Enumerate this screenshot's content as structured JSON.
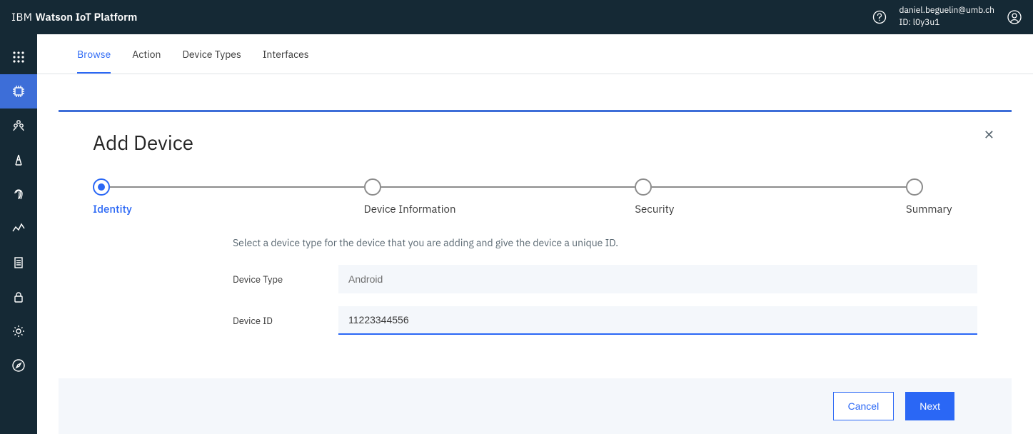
{
  "header": {
    "brand_prefix": "IBM",
    "brand_bold": "Watson IoT Platform",
    "user_email": "daniel.beguelin@umb.ch",
    "user_id_label": "ID: l0y3u1"
  },
  "tabs": {
    "items": [
      "Browse",
      "Action",
      "Device Types",
      "Interfaces"
    ],
    "active_index": 0
  },
  "panel": {
    "title": "Add Device",
    "close_glyph": "✕",
    "steps": [
      "Identity",
      "Device Information",
      "Security",
      "Summary"
    ],
    "active_step": 0,
    "description": "Select a device type for the device that you are adding and give the device a unique ID.",
    "fields": {
      "device_type": {
        "label": "Device Type",
        "value": "Android"
      },
      "device_id": {
        "label": "Device ID",
        "value": "11223344556"
      }
    },
    "buttons": {
      "cancel": "Cancel",
      "next": "Next"
    }
  },
  "sidebar": {
    "items": [
      "apps",
      "chip",
      "members",
      "compass",
      "fingerprint",
      "analytics",
      "document",
      "lock",
      "settings",
      "explore"
    ],
    "active_index": 1
  }
}
